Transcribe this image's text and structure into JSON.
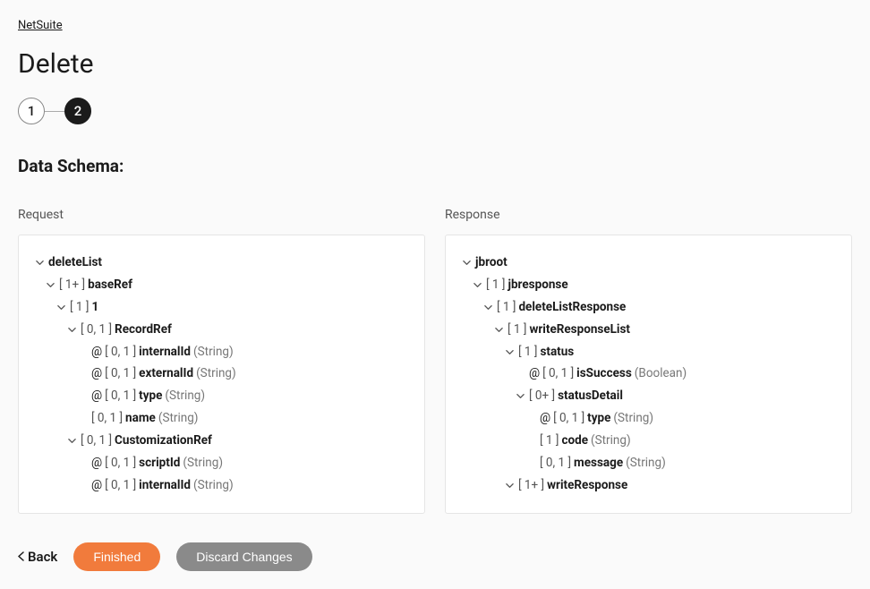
{
  "breadcrumb": "NetSuite",
  "title": "Delete",
  "stepper": {
    "step1": "1",
    "step2": "2"
  },
  "section_title": "Data Schema:",
  "columns": {
    "request": {
      "header": "Request",
      "rows": [
        {
          "indent": 0,
          "chev": true,
          "name": "deleteList"
        },
        {
          "indent": 1,
          "chev": true,
          "card": "[ 1+ ]",
          "name": "baseRef"
        },
        {
          "indent": 2,
          "chev": true,
          "card": "[ 1 ]",
          "name": "1"
        },
        {
          "indent": 3,
          "chev": true,
          "card": "[ 0, 1 ]",
          "name": "RecordRef"
        },
        {
          "indent": 4,
          "at": true,
          "card": "[ 0, 1 ]",
          "name": "internalId",
          "type": "(String)"
        },
        {
          "indent": 4,
          "at": true,
          "card": "[ 0, 1 ]",
          "name": "externalId",
          "type": "(String)"
        },
        {
          "indent": 4,
          "at": true,
          "card": "[ 0, 1 ]",
          "name": "type",
          "type": "(String)"
        },
        {
          "indent": 4,
          "card": "[ 0, 1 ]",
          "name": "name",
          "type": "(String)"
        },
        {
          "indent": 3,
          "chev": true,
          "card": "[ 0, 1 ]",
          "name": "CustomizationRef"
        },
        {
          "indent": 4,
          "at": true,
          "card": "[ 0, 1 ]",
          "name": "scriptId",
          "type": "(String)"
        },
        {
          "indent": 4,
          "at": true,
          "card": "[ 0, 1 ]",
          "name": "internalId",
          "type": "(String)"
        }
      ]
    },
    "response": {
      "header": "Response",
      "rows": [
        {
          "indent": 0,
          "chev": true,
          "name": "jbroot"
        },
        {
          "indent": 1,
          "chev": true,
          "card": "[ 1 ]",
          "name": "jbresponse"
        },
        {
          "indent": 2,
          "chev": true,
          "card": "[ 1 ]",
          "name": "deleteListResponse"
        },
        {
          "indent": 3,
          "chev": true,
          "card": "[ 1 ]",
          "name": "writeResponseList"
        },
        {
          "indent": 4,
          "chev": true,
          "card": "[ 1 ]",
          "name": "status"
        },
        {
          "indent": 5,
          "at": true,
          "card": "[ 0, 1 ]",
          "name": "isSuccess",
          "type": "(Boolean)"
        },
        {
          "indent": 5,
          "chev": true,
          "card": "[ 0+ ]",
          "name": "statusDetail"
        },
        {
          "indent": 6,
          "at": true,
          "card": "[ 0, 1 ]",
          "name": "type",
          "type": "(String)"
        },
        {
          "indent": 6,
          "card": "[ 1 ]",
          "name": "code",
          "type": "(String)"
        },
        {
          "indent": 6,
          "card": "[ 0, 1 ]",
          "name": "message",
          "type": "(String)"
        },
        {
          "indent": 4,
          "chev": true,
          "card": "[ 1+ ]",
          "name": "writeResponse"
        }
      ]
    }
  },
  "footer": {
    "back": "Back",
    "finished": "Finished",
    "discard": "Discard Changes"
  }
}
